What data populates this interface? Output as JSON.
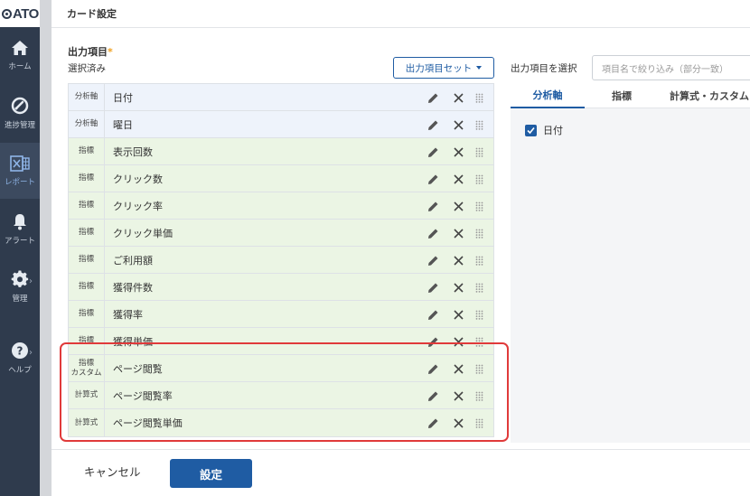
{
  "app": {
    "logo_text": "ATO"
  },
  "nav": {
    "items": [
      {
        "label": "ホーム",
        "icon": "home-icon"
      },
      {
        "label": "進捗管理",
        "icon": "progress-icon"
      },
      {
        "label": "レポート",
        "icon": "report-icon",
        "active": true
      },
      {
        "label": "アラート",
        "icon": "bell-icon"
      },
      {
        "label": "管理",
        "icon": "gear-icon"
      },
      {
        "label": "ヘルプ",
        "icon": "help-icon"
      }
    ]
  },
  "modal": {
    "title": "カード設定",
    "section_title": "出力項目",
    "required_mark": "*",
    "selected_label": "選択済み",
    "preset_button": "出力項目セット",
    "rows": [
      {
        "type": "分析軸",
        "name": "日付",
        "kind": "axis"
      },
      {
        "type": "分析軸",
        "name": "曜日",
        "kind": "axis"
      },
      {
        "type": "指標",
        "name": "表示回数",
        "kind": "metric"
      },
      {
        "type": "指標",
        "name": "クリック数",
        "kind": "metric"
      },
      {
        "type": "指標",
        "name": "クリック率",
        "kind": "metric"
      },
      {
        "type": "指標",
        "name": "クリック単価",
        "kind": "metric"
      },
      {
        "type": "指標",
        "name": "ご利用額",
        "kind": "metric"
      },
      {
        "type": "指標",
        "name": "獲得件数",
        "kind": "metric"
      },
      {
        "type": "指標",
        "name": "獲得率",
        "kind": "metric"
      },
      {
        "type": "指標",
        "name": "獲得単価",
        "kind": "metric"
      },
      {
        "type": "指標",
        "type2": "カスタム",
        "name": "ページ閲覧",
        "kind": "metric"
      },
      {
        "type": "計算式",
        "name": "ページ閲覧率",
        "kind": "metric"
      },
      {
        "type": "計算式",
        "name": "ページ閲覧単価",
        "kind": "metric"
      }
    ],
    "right": {
      "select_label": "出力項目を選択",
      "filter_placeholder": "項目名で絞り込み（部分一致）",
      "tabs": [
        "分析軸",
        "指標",
        "計算式・カスタム"
      ],
      "active_tab": 0,
      "checked_items": [
        "日付"
      ]
    },
    "footer": {
      "cancel": "キャンセル",
      "submit": "設定"
    }
  },
  "colors": {
    "accent": "#1f5ca3",
    "axis_row": "#eef3fb",
    "metric_row": "#ebf5e4",
    "highlight": "#e03a3a",
    "nav_bg": "#2f3b4d"
  }
}
